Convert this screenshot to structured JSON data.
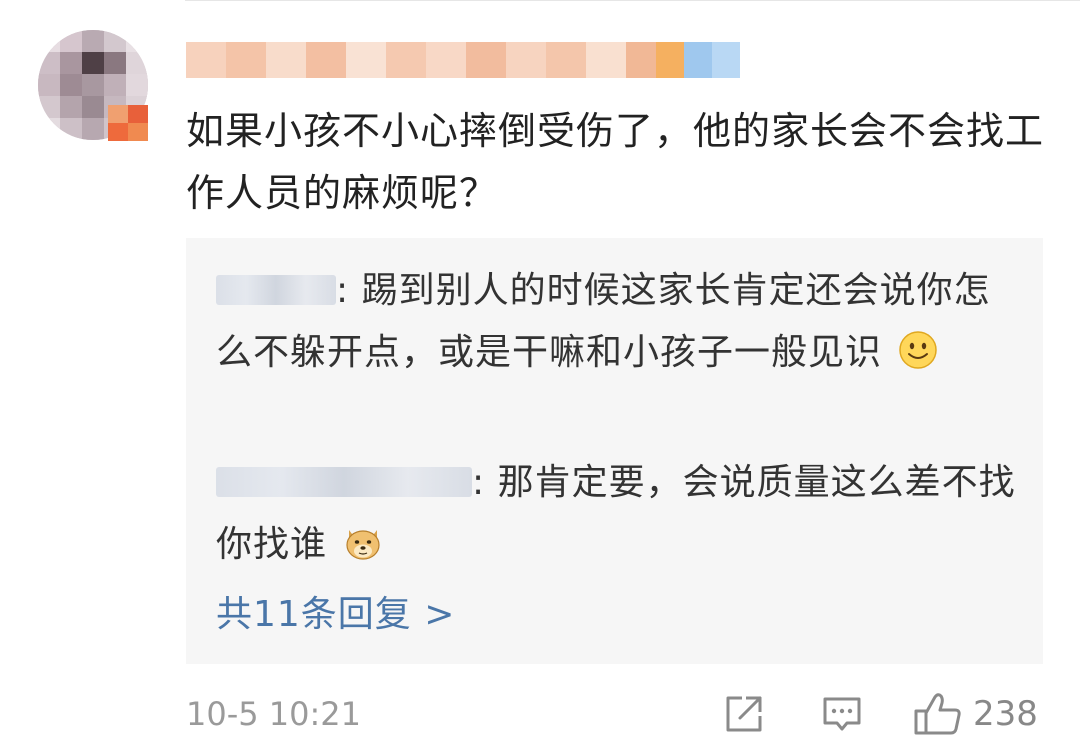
{
  "comment": {
    "text": "如果小孩不小心摔倒受伤了，他的家长会不会找工作人员的麻烦呢？",
    "timestamp": "10-5 10:21",
    "like_count": "238"
  },
  "replies": [
    {
      "separator": ":",
      "text": "踢到别人的时候这家长肯定还会说你怎么不躲开点，或是干嘛和小孩子一般见识",
      "emoji": "smile-emoji"
    },
    {
      "separator": ":",
      "text": "那肯定要，会说质量这么差不找你找谁",
      "emoji": "doge-emoji"
    }
  ],
  "more_replies_label": "共11条回复 >",
  "icons": {
    "share": "share-icon",
    "comment": "comment-icon",
    "like": "thumbs-up-icon"
  },
  "colors": {
    "link": "#4a76a8",
    "reply_bg": "#f6f6f6",
    "meta_text": "#9a9a9a"
  }
}
